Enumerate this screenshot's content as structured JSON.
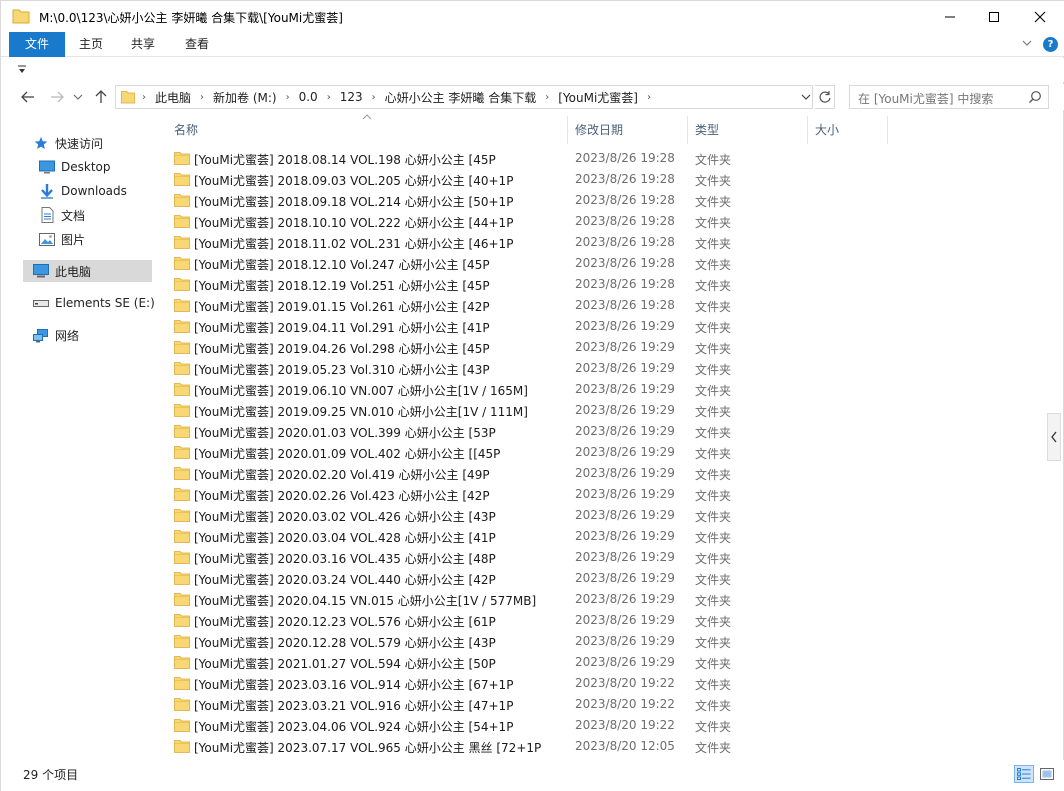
{
  "window": {
    "title": "M:\\0.0\\123\\心妍小公主 李妍曦 合集下载\\[YouMi尤蜜荟]"
  },
  "ribbon": {
    "tabs": [
      "文件",
      "主页",
      "共享",
      "查看"
    ],
    "help": "?"
  },
  "address": {
    "crumbs": [
      "此电脑",
      "新加卷 (M:)",
      "0.0",
      "123",
      "心妍小公主 李妍曦 合集下载",
      "[YouMi尤蜜荟]"
    ]
  },
  "search": {
    "placeholder": "在 [YouMi尤蜜荟] 中搜索"
  },
  "sidebar": {
    "items": [
      {
        "label": "快速访问",
        "icon": "star-icon"
      },
      {
        "label": "Desktop",
        "icon": "desktop-icon"
      },
      {
        "label": "Downloads",
        "icon": "download-icon"
      },
      {
        "label": "文档",
        "icon": "document-icon"
      },
      {
        "label": "图片",
        "icon": "picture-icon"
      },
      {
        "label": "此电脑",
        "icon": "computer-icon"
      },
      {
        "label": "Elements SE (E:)",
        "icon": "drive-icon"
      },
      {
        "label": "网络",
        "icon": "network-icon"
      }
    ]
  },
  "columns": {
    "name": "名称",
    "date": "修改日期",
    "type": "类型",
    "size": "大小"
  },
  "files": [
    {
      "name": "[YouMi尤蜜荟] 2018.08.14 VOL.198 心妍小公主 [45P",
      "date": "2023/8/26 19:28",
      "type": "文件夹"
    },
    {
      "name": "[YouMi尤蜜荟] 2018.09.03 VOL.205 心妍小公主 [40+1P",
      "date": "2023/8/26 19:28",
      "type": "文件夹"
    },
    {
      "name": "[YouMi尤蜜荟] 2018.09.18 VOL.214 心妍小公主 [50+1P",
      "date": "2023/8/26 19:28",
      "type": "文件夹"
    },
    {
      "name": "[YouMi尤蜜荟] 2018.10.10 VOL.222 心妍小公主 [44+1P",
      "date": "2023/8/26 19:28",
      "type": "文件夹"
    },
    {
      "name": "[YouMi尤蜜荟] 2018.11.02 VOL.231 心妍小公主 [46+1P",
      "date": "2023/8/26 19:28",
      "type": "文件夹"
    },
    {
      "name": "[YouMi尤蜜荟] 2018.12.10 Vol.247 心妍小公主 [45P",
      "date": "2023/8/26 19:28",
      "type": "文件夹"
    },
    {
      "name": "[YouMi尤蜜荟] 2018.12.19 Vol.251 心妍小公主 [45P",
      "date": "2023/8/26 19:28",
      "type": "文件夹"
    },
    {
      "name": "[YouMi尤蜜荟] 2019.01.15 Vol.261 心妍小公主 [42P",
      "date": "2023/8/26 19:28",
      "type": "文件夹"
    },
    {
      "name": "[YouMi尤蜜荟] 2019.04.11 Vol.291 心妍小公主 [41P",
      "date": "2023/8/26 19:29",
      "type": "文件夹"
    },
    {
      "name": "[YouMi尤蜜荟] 2019.04.26 Vol.298 心妍小公主 [45P",
      "date": "2023/8/26 19:29",
      "type": "文件夹"
    },
    {
      "name": "[YouMi尤蜜荟] 2019.05.23 Vol.310 心妍小公主 [43P",
      "date": "2023/8/26 19:29",
      "type": "文件夹"
    },
    {
      "name": "[YouMi尤蜜荟] 2019.06.10 VN.007 心妍小公主[1V / 165M]",
      "date": "2023/8/26 19:29",
      "type": "文件夹"
    },
    {
      "name": "[YouMi尤蜜荟] 2019.09.25 VN.010 心妍小公主[1V / 111M]",
      "date": "2023/8/26 19:29",
      "type": "文件夹"
    },
    {
      "name": "[YouMi尤蜜荟] 2020.01.03 VOL.399 心妍小公主 [53P",
      "date": "2023/8/26 19:29",
      "type": "文件夹"
    },
    {
      "name": "[YouMi尤蜜荟] 2020.01.09 VOL.402 心妍小公主 [[45P",
      "date": "2023/8/26 19:29",
      "type": "文件夹"
    },
    {
      "name": "[YouMi尤蜜荟] 2020.02.20 Vol.419 心妍小公主 [49P",
      "date": "2023/8/26 19:29",
      "type": "文件夹"
    },
    {
      "name": "[YouMi尤蜜荟] 2020.02.26 Vol.423 心妍小公主 [42P",
      "date": "2023/8/26 19:29",
      "type": "文件夹"
    },
    {
      "name": "[YouMi尤蜜荟] 2020.03.02 VOL.426 心妍小公主 [43P",
      "date": "2023/8/26 19:29",
      "type": "文件夹"
    },
    {
      "name": "[YouMi尤蜜荟] 2020.03.04 VOL.428 心妍小公主 [41P",
      "date": "2023/8/26 19:29",
      "type": "文件夹"
    },
    {
      "name": "[YouMi尤蜜荟] 2020.03.16 VOL.435 心妍小公主 [48P",
      "date": "2023/8/26 19:29",
      "type": "文件夹"
    },
    {
      "name": "[YouMi尤蜜荟] 2020.03.24 VOL.440 心妍小公主 [42P",
      "date": "2023/8/26 19:29",
      "type": "文件夹"
    },
    {
      "name": "[YouMi尤蜜荟] 2020.04.15 VN.015 心妍小公主[1V / 577MB]",
      "date": "2023/8/26 19:29",
      "type": "文件夹"
    },
    {
      "name": "[YouMi尤蜜荟] 2020.12.23 VOL.576 心妍小公主 [61P",
      "date": "2023/8/26 19:29",
      "type": "文件夹"
    },
    {
      "name": "[YouMi尤蜜荟] 2020.12.28 VOL.579 心妍小公主 [43P",
      "date": "2023/8/26 19:29",
      "type": "文件夹"
    },
    {
      "name": "[YouMi尤蜜荟] 2021.01.27 VOL.594 心妍小公主 [50P",
      "date": "2023/8/26 19:29",
      "type": "文件夹"
    },
    {
      "name": "[YouMi尤蜜荟] 2023.03.16 VOL.914 心妍小公主 [67+1P",
      "date": "2023/8/20 19:22",
      "type": "文件夹"
    },
    {
      "name": "[YouMi尤蜜荟] 2023.03.21 VOL.916 心妍小公主 [47+1P",
      "date": "2023/8/20 19:22",
      "type": "文件夹"
    },
    {
      "name": "[YouMi尤蜜荟] 2023.04.06 VOL.924 心妍小公主 [54+1P",
      "date": "2023/8/20 19:22",
      "type": "文件夹"
    },
    {
      "name": "[YouMi尤蜜荟] 2023.07.17 VOL.965 心妍小公主 黑丝 [72+1P",
      "date": "2023/8/20 12:05",
      "type": "文件夹"
    }
  ],
  "status": {
    "count": "29 个项目"
  },
  "colors": {
    "accent": "#1979ca",
    "folder": "#f8d775",
    "selected_nav": "#d9d9d9",
    "header_text": "#4c607a"
  }
}
